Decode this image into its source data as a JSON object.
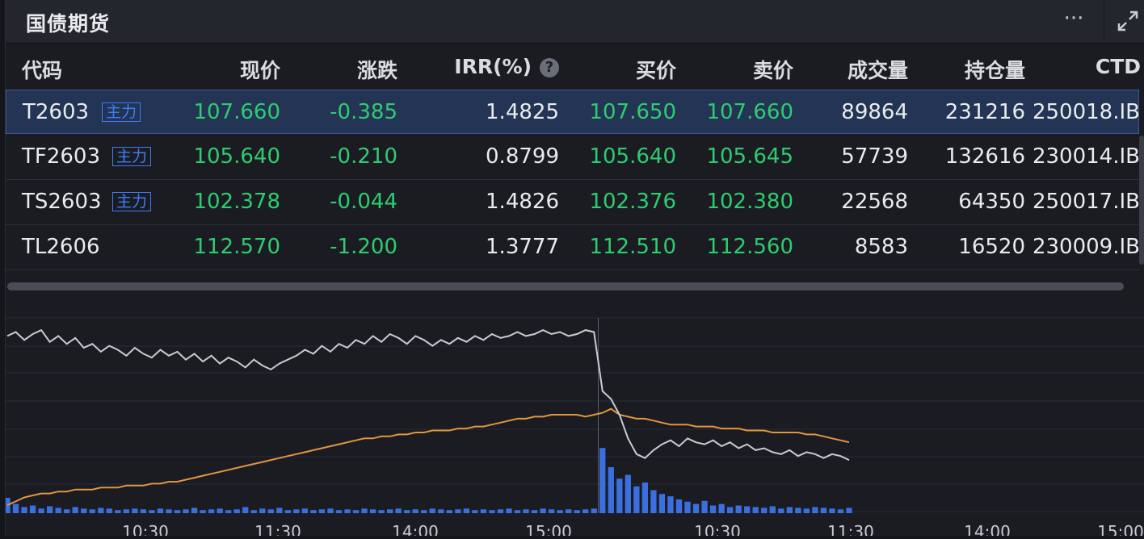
{
  "panel": {
    "title": "国债期货"
  },
  "header": {
    "more_label": "···"
  },
  "table": {
    "columns": {
      "code": "代码",
      "price": "现价",
      "change": "涨跌",
      "irr": "IRR(%)",
      "bid": "买价",
      "ask": "卖价",
      "volume": "成交量",
      "oi": "持仓量",
      "ctd": "CTD"
    },
    "help_glyph": "?",
    "rows": [
      {
        "code": "T2603",
        "badge": "主力",
        "price": "107.660",
        "change": "-0.385",
        "irr": "1.4825",
        "bid": "107.650",
        "ask": "107.660",
        "volume": "89864",
        "oi": "231216",
        "ctd": "250018.IB"
      },
      {
        "code": "TF2603",
        "badge": "主力",
        "price": "105.640",
        "change": "-0.210",
        "irr": "0.8799",
        "bid": "105.640",
        "ask": "105.645",
        "volume": "57739",
        "oi": "132616",
        "ctd": "230014.IB"
      },
      {
        "code": "TS2603",
        "badge": "主力",
        "price": "102.378",
        "change": "-0.044",
        "irr": "1.4826",
        "bid": "102.376",
        "ask": "102.380",
        "volume": "22568",
        "oi": "64350",
        "ctd": "250017.IB"
      },
      {
        "code": "TL2606",
        "badge": "",
        "price": "112.570",
        "change": "-1.200",
        "irr": "1.3777",
        "bid": "112.510",
        "ask": "112.560",
        "volume": "8583",
        "oi": "16520",
        "ctd": "230009.IB"
      }
    ]
  },
  "colors": {
    "price_line": "#c9ccd2",
    "avg_line": "#e0963f",
    "volume_bar": "#3b6fe0",
    "positive": "#2ecc71",
    "badge": "#3f7df6"
  },
  "chart_data": {
    "type": "line",
    "x_ticks": [
      "10:30",
      "11:30",
      "14:00",
      "15:00",
      "10:30",
      "11:30",
      "14:00",
      "15:00"
    ],
    "series": [
      {
        "values": [
          0.9,
          0.92,
          0.88,
          0.91,
          0.93,
          0.87,
          0.9,
          0.86,
          0.89,
          0.84,
          0.86,
          0.82,
          0.85,
          0.83,
          0.8,
          0.84,
          0.81,
          0.79,
          0.83,
          0.8,
          0.82,
          0.78,
          0.81,
          0.77,
          0.8,
          0.76,
          0.79,
          0.77,
          0.74,
          0.78,
          0.75,
          0.73,
          0.76,
          0.78,
          0.8,
          0.83,
          0.81,
          0.85,
          0.82,
          0.86,
          0.84,
          0.88,
          0.86,
          0.9,
          0.87,
          0.91,
          0.89,
          0.86,
          0.9,
          0.88,
          0.85,
          0.88,
          0.86,
          0.89,
          0.87,
          0.9,
          0.88,
          0.91,
          0.89,
          0.9,
          0.92,
          0.9,
          0.91,
          0.93,
          0.91,
          0.92,
          0.9,
          0.91,
          0.93,
          0.92,
          0.62,
          0.58,
          0.5,
          0.38,
          0.3,
          0.28,
          0.32,
          0.35,
          0.37,
          0.34,
          0.38,
          0.36,
          0.35,
          0.37,
          0.34,
          0.36,
          0.33,
          0.35,
          0.32,
          0.33,
          0.31,
          0.3,
          0.32,
          0.29,
          0.31,
          0.3,
          0.28,
          0.3,
          0.29,
          0.27
        ]
      },
      {
        "values": [
          0.04,
          0.06,
          0.08,
          0.09,
          0.1,
          0.1,
          0.11,
          0.11,
          0.12,
          0.12,
          0.12,
          0.13,
          0.13,
          0.13,
          0.14,
          0.14,
          0.14,
          0.15,
          0.15,
          0.16,
          0.16,
          0.17,
          0.18,
          0.19,
          0.2,
          0.21,
          0.22,
          0.23,
          0.24,
          0.25,
          0.26,
          0.27,
          0.28,
          0.29,
          0.3,
          0.31,
          0.32,
          0.33,
          0.34,
          0.35,
          0.36,
          0.37,
          0.38,
          0.38,
          0.39,
          0.39,
          0.4,
          0.4,
          0.41,
          0.41,
          0.42,
          0.42,
          0.42,
          0.43,
          0.43,
          0.44,
          0.44,
          0.45,
          0.46,
          0.47,
          0.48,
          0.48,
          0.49,
          0.49,
          0.5,
          0.5,
          0.5,
          0.5,
          0.49,
          0.5,
          0.51,
          0.53,
          0.5,
          0.49,
          0.48,
          0.48,
          0.47,
          0.46,
          0.45,
          0.45,
          0.45,
          0.44,
          0.44,
          0.44,
          0.43,
          0.43,
          0.43,
          0.42,
          0.42,
          0.42,
          0.41,
          0.41,
          0.41,
          0.41,
          0.4,
          0.4,
          0.39,
          0.38,
          0.37,
          0.36
        ]
      }
    ],
    "volume": [
      0.2,
      0.12,
      0.08,
      0.1,
      0.06,
      0.09,
      0.07,
      0.05,
      0.08,
      0.06,
      0.05,
      0.07,
      0.06,
      0.04,
      0.05,
      0.06,
      0.05,
      0.04,
      0.06,
      0.05,
      0.04,
      0.05,
      0.07,
      0.04,
      0.05,
      0.06,
      0.04,
      0.05,
      0.08,
      0.04,
      0.06,
      0.05,
      0.07,
      0.04,
      0.05,
      0.06,
      0.04,
      0.05,
      0.06,
      0.04,
      0.05,
      0.04,
      0.06,
      0.05,
      0.04,
      0.05,
      0.06,
      0.04,
      0.05,
      0.04,
      0.06,
      0.05,
      0.04,
      0.05,
      0.06,
      0.04,
      0.05,
      0.04,
      0.05,
      0.06,
      0.04,
      0.05,
      0.04,
      0.06,
      0.05,
      0.04,
      0.05,
      0.04,
      0.05,
      0.06,
      0.85,
      0.6,
      0.45,
      0.5,
      0.35,
      0.4,
      0.3,
      0.25,
      0.22,
      0.18,
      0.15,
      0.12,
      0.16,
      0.1,
      0.12,
      0.08,
      0.1,
      0.09,
      0.08,
      0.07,
      0.09,
      0.06,
      0.08,
      0.07,
      0.06,
      0.08,
      0.07,
      0.06,
      0.05,
      0.07
    ],
    "grid": true
  }
}
